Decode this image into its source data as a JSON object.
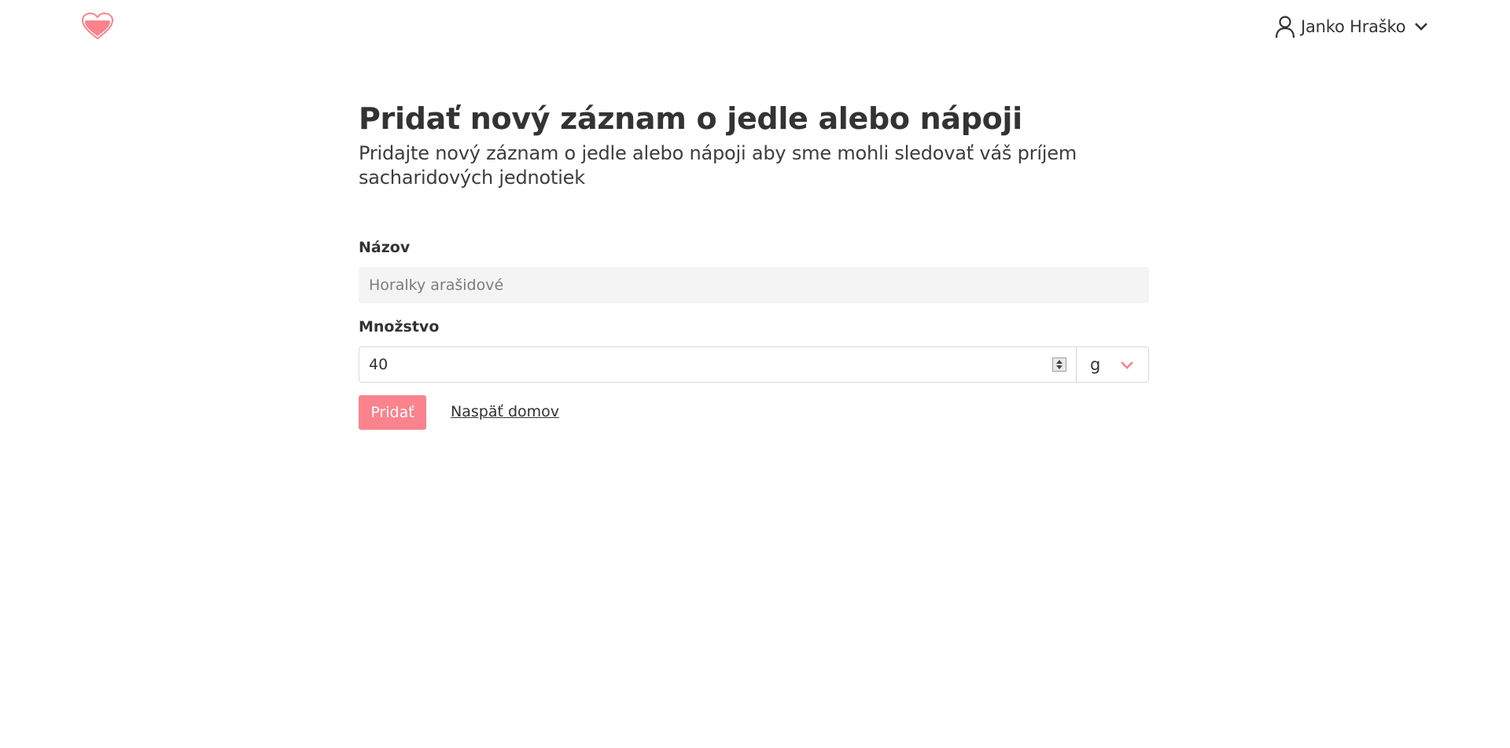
{
  "header": {
    "logo_icon": "heart-icon",
    "user_icon": "user-icon",
    "user_name": "Janko Hraško",
    "user_menu_icon": "chevron-down-icon"
  },
  "page": {
    "title": "Pridať nový záznam o jedle alebo nápoji",
    "subtitle": "Pridajte nový záznam o jedle alebo nápoji aby sme mohli sledovať váš príjem sacharidových jednotiek"
  },
  "form": {
    "name_label": "Názov",
    "name_placeholder": "Horalky arašidové",
    "name_value": "",
    "quantity_label": "Množstvo",
    "quantity_value": "40",
    "unit_selected": "g",
    "unit_icon": "chevron-down-icon",
    "submit_label": "Pridať",
    "back_label": "Naspäť domov"
  },
  "colors": {
    "accent": "#fa838d",
    "input_background": "#f4f4f4",
    "text": "#333333"
  }
}
